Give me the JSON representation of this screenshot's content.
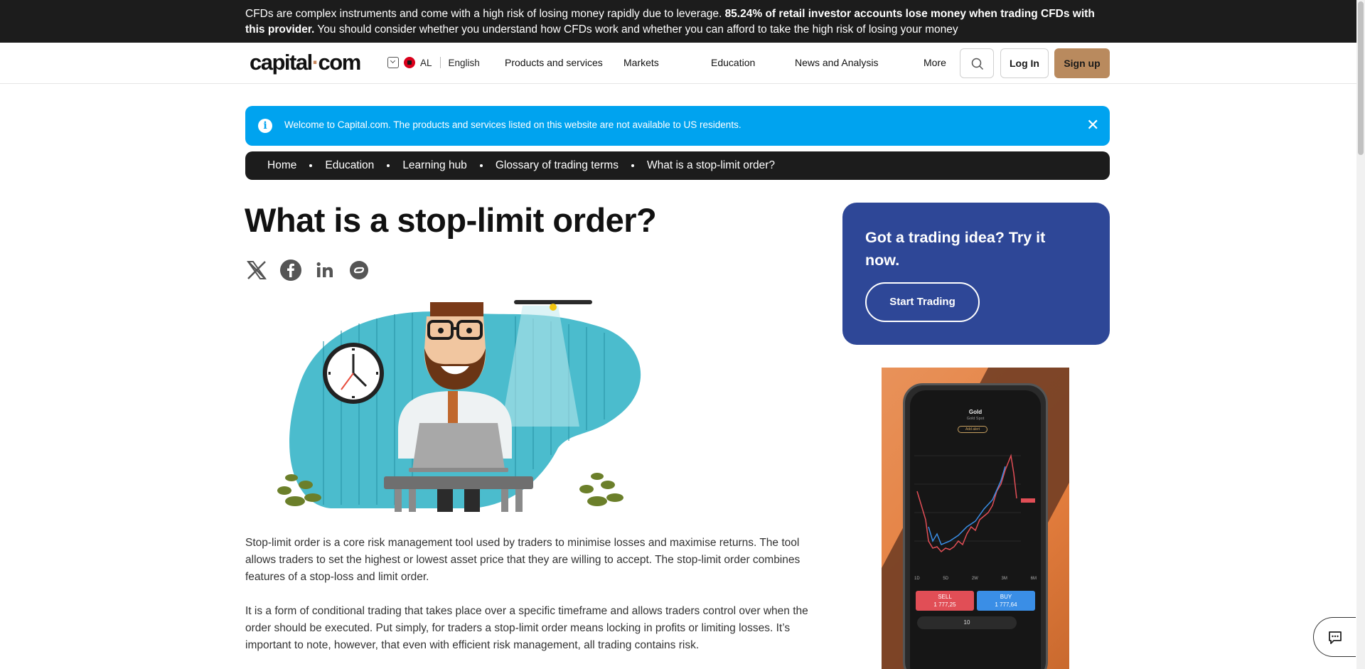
{
  "risk_warning": {
    "text_normal_1": "CFDs are complex instruments and come with a high risk of losing money rapidly due to leverage. ",
    "text_bold": "85.24% of retail investor accounts lose money when trading CFDs with this provider.",
    "text_normal_2": " You should consider whether you understand how CFDs work and whether you can afford to take the high risk of losing your money"
  },
  "header": {
    "logo_part1": "capital",
    "logo_dot": "·",
    "logo_part2": "com",
    "region": "AL",
    "language": "English",
    "nav": [
      "Products and services",
      "Markets",
      "Education",
      "News and Analysis",
      "More"
    ],
    "login_label": "Log In",
    "signup_label": "Sign up"
  },
  "info_banner": {
    "icon": "i",
    "text": "Welcome to Capital.com. The products and services listed on this website are not available to US residents.",
    "close": "✕"
  },
  "breadcrumb": [
    "Home",
    "Education",
    "Learning hub",
    "Glossary of trading terms",
    "What is a stop-limit order?"
  ],
  "article": {
    "title": "What is a stop-limit order?",
    "share_icons": [
      "x-icon",
      "facebook-icon",
      "linkedin-icon",
      "share-link-icon"
    ],
    "paragraphs": [
      "Stop-limit order is a core risk management tool used by traders to minimise losses and maximise returns. The tool allows traders to set the highest or lowest asset price that they are willing to accept. The stop-limit order combines features of a stop-loss and limit order.",
      "It is a form of conditional trading that takes place over a specific timeframe and allows traders control over when the order should be executed. Put simply, for traders a stop-limit order means locking in profits or limiting losses. It’s important to note, however, that even with efficient risk management, all trading contains risk."
    ]
  },
  "sidebar": {
    "cta_title": "Got a trading idea? Try it now.",
    "cta_button": "Start Trading",
    "ad": {
      "instrument": "Gold",
      "instrument_sub": "Gold Spot",
      "alert_label": "Add alert",
      "timeframes": [
        "1D",
        "5D",
        "2W",
        "3M",
        "6M"
      ],
      "sell_label": "SELL",
      "sell_price": "1 777,25",
      "buy_label": "BUY",
      "buy_price": "1 777,64",
      "quantity": "10"
    }
  },
  "colors": {
    "risk_bar": "#1c1c1c",
    "signup": "#b98a5e",
    "info_banner": "#00a3ef",
    "cta_card": "#2e4797"
  }
}
